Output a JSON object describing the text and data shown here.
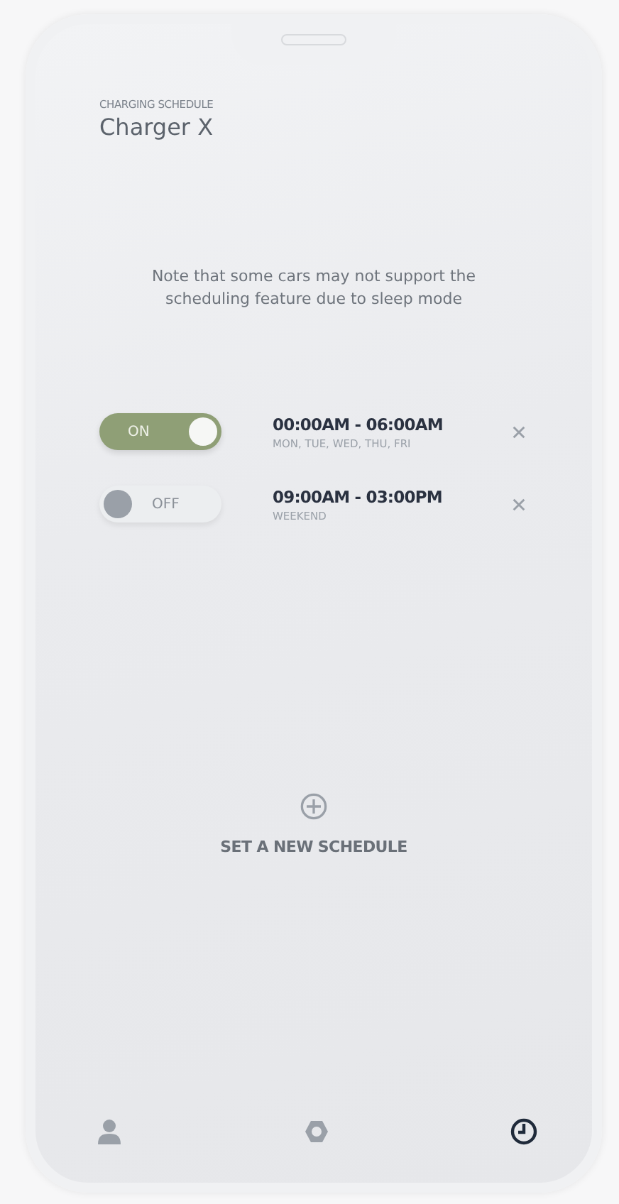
{
  "header": {
    "eyebrow": "CHARGING SCHEDULE",
    "title": "Charger X"
  },
  "note": "Note that some cars may not support the scheduling feature due to sleep mode",
  "schedules": [
    {
      "on": true,
      "toggle_label": "ON",
      "time": "00:00AM - 06:00AM",
      "days": "MON, TUE, WED, THU, FRI"
    },
    {
      "on": false,
      "toggle_label": "OFF",
      "time": "09:00AM - 03:00PM",
      "days": "WEEKEND"
    }
  ],
  "add_schedule": {
    "label": "SET A NEW SCHEDULE"
  },
  "nav": [
    {
      "kind": "profile",
      "selected": false
    },
    {
      "kind": "settings",
      "selected": false
    },
    {
      "kind": "schedule",
      "selected": true
    }
  ]
}
